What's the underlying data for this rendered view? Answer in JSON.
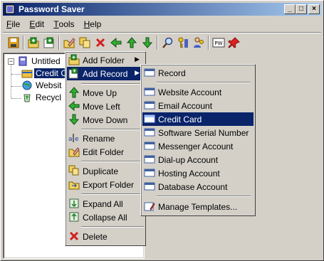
{
  "window": {
    "title": "Password Saver",
    "minimize": "_",
    "maximize": "□",
    "close": "×"
  },
  "menubar": [
    {
      "label": "File",
      "accel": "F",
      "rest": "ile"
    },
    {
      "label": "Edit",
      "accel": "E",
      "rest": "dit"
    },
    {
      "label": "Tools",
      "accel": "T",
      "rest": "ools"
    },
    {
      "label": "Help",
      "accel": "H",
      "rest": "elp"
    }
  ],
  "toolbar": {
    "buttons": [
      "save-icon",
      "add-folder-icon",
      "add-record-icon",
      "edit-icon",
      "duplicate-icon",
      "delete-icon",
      "move-left-icon",
      "move-up-icon",
      "move-down-icon",
      "search-icon",
      "key-icon",
      "users-icon",
      "pw-icon",
      "pin-icon"
    ],
    "pw_label": "PW"
  },
  "tree": {
    "root": "Untitled",
    "items": [
      "Credit C",
      "Websit",
      "Recycl"
    ]
  },
  "context_menu": {
    "items": [
      {
        "label": "Add Folder",
        "icon": "add-folder-icon",
        "submenu": true
      },
      {
        "label": "Add Record",
        "icon": "add-record-icon",
        "submenu": true,
        "highlighted": true
      },
      {
        "label": "Move Up",
        "icon": "arrow-up-icon"
      },
      {
        "label": "Move Left",
        "icon": "arrow-left-icon"
      },
      {
        "label": "Move Down",
        "icon": "arrow-down-icon"
      },
      {
        "label": "Rename",
        "icon": "rename-icon"
      },
      {
        "label": "Edit Folder",
        "icon": "edit-folder-icon"
      },
      {
        "label": "Duplicate",
        "icon": "duplicate-icon"
      },
      {
        "label": "Export Folder",
        "icon": "export-icon"
      },
      {
        "label": "Expand All",
        "icon": "expand-icon"
      },
      {
        "label": "Collapse All",
        "icon": "collapse-icon"
      },
      {
        "label": "Delete",
        "icon": "delete-icon"
      }
    ]
  },
  "submenu": {
    "items": [
      {
        "label": "Record"
      },
      {
        "label": "Website Account"
      },
      {
        "label": "Email Account"
      },
      {
        "label": "Credit Card",
        "highlighted": true
      },
      {
        "label": "Software Serial Number"
      },
      {
        "label": "Messenger Account"
      },
      {
        "label": "Dial-up Account"
      },
      {
        "label": "Hosting Account"
      },
      {
        "label": "Database Account"
      },
      {
        "label": "Manage Templates..."
      }
    ]
  },
  "colors": {
    "face": "#d4d0c8",
    "highlight": "#0a246a",
    "title_start": "#0a246a",
    "title_end": "#a6caf0"
  }
}
